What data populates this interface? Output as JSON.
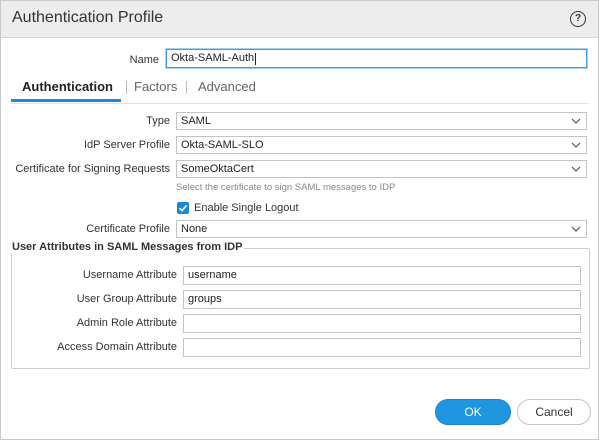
{
  "dialog": {
    "title": "Authentication Profile",
    "help_icon": "question-circle-icon"
  },
  "name_field": {
    "label": "Name",
    "value": "Okta-SAML-Auth"
  },
  "tabs": [
    {
      "label": "Authentication",
      "active": true
    },
    {
      "label": "Factors",
      "active": false
    },
    {
      "label": "Advanced",
      "active": false
    }
  ],
  "form": {
    "type": {
      "label": "Type",
      "value": "SAML"
    },
    "idp_server_profile": {
      "label": "IdP Server Profile",
      "value": "Okta-SAML-SLO"
    },
    "cert_signing": {
      "label": "Certificate for Signing Requests",
      "value": "SomeOktaCert",
      "hint": "Select the certificate to sign SAML messages to IDP"
    },
    "single_logout": {
      "label": "Enable Single Logout",
      "checked": true
    },
    "cert_profile": {
      "label": "Certificate Profile",
      "value": "None"
    }
  },
  "user_attributes": {
    "legend": "User Attributes in SAML Messages from IDP",
    "username": {
      "label": "Username Attribute",
      "value": "username"
    },
    "user_group": {
      "label": "User Group Attribute",
      "value": "groups"
    },
    "admin_role": {
      "label": "Admin Role Attribute",
      "value": ""
    },
    "access_domain": {
      "label": "Access Domain Attribute",
      "value": ""
    }
  },
  "buttons": {
    "ok": "OK",
    "cancel": "Cancel"
  },
  "colors": {
    "accent": "#1e88d3",
    "title_bar": "#ededed"
  }
}
